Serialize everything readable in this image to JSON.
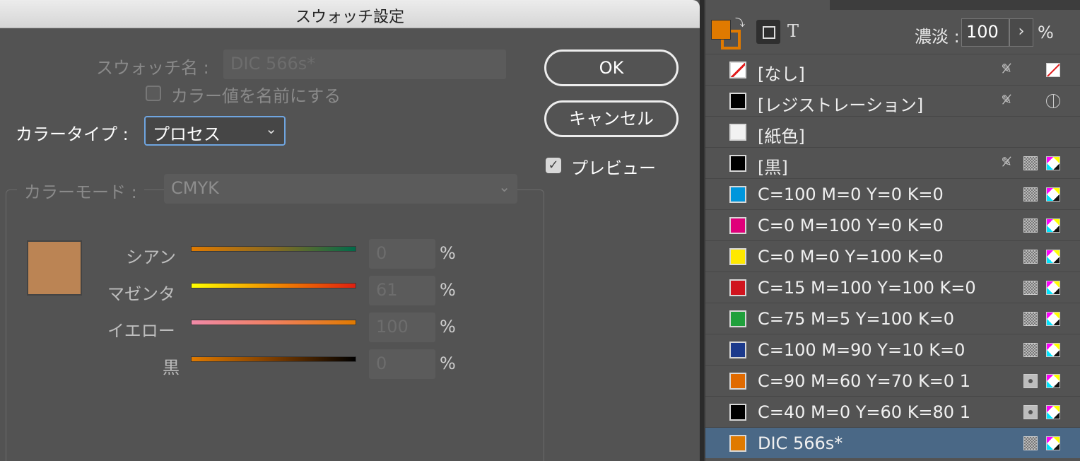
{
  "dialog": {
    "title": "スウォッチ設定",
    "swatch_name_label": "スウォッチ名 :",
    "swatch_name_value": "DIC 566s*",
    "name_with_value_label": "カラー値を名前にする",
    "color_type_label": "カラータイプ :",
    "color_type_value": "プロセス",
    "color_mode_label": "カラーモード :",
    "color_mode_value": "CMYK",
    "preview_color": "#bb8454",
    "sliders": [
      {
        "label": "シアン",
        "value": "0",
        "unit": "%"
      },
      {
        "label": "マゼンタ",
        "value": "61",
        "unit": "%"
      },
      {
        "label": "イエロー",
        "value": "100",
        "unit": "%"
      },
      {
        "label": "黒",
        "value": "0",
        "unit": "%"
      }
    ],
    "ok_label": "OK",
    "cancel_label": "キャンセル",
    "preview_label": "プレビュー",
    "preview_checked": true,
    "name_with_value_checked": false
  },
  "panel": {
    "tint_label": "濃淡 :",
    "tint_value": "100",
    "tint_unit": "%",
    "swatches": [
      {
        "name": "[なし]",
        "color": "none"
      },
      {
        "name": "[レジストレーション]",
        "color": "#000000"
      },
      {
        "name": "[紙色]",
        "color": "#f2f2f2"
      },
      {
        "name": "[黒]",
        "color": "#000000"
      },
      {
        "name": "C=100 M=0 Y=0 K=0",
        "color": "#0096dc"
      },
      {
        "name": "C=0 M=100 Y=0 K=0",
        "color": "#e0007a"
      },
      {
        "name": "C=0 M=0 Y=100 K=0",
        "color": "#ffe800"
      },
      {
        "name": "C=15 M=100 Y=100 K=0",
        "color": "#d0141e"
      },
      {
        "name": "C=75 M=5 Y=100 K=0",
        "color": "#20a03c"
      },
      {
        "name": "C=100 M=90 Y=10 K=0",
        "color": "#1c3a8c"
      },
      {
        "name": "C=90 M=60 Y=70 K=0 1",
        "color": "#e06a00"
      },
      {
        "name": "C=40 M=0 Y=60 K=80 1",
        "color": "#000000"
      },
      {
        "name": "DIC 566s*",
        "color": "#e07a00"
      }
    ],
    "accent_color": "#e07a00",
    "selection_color": "#4a6886"
  }
}
